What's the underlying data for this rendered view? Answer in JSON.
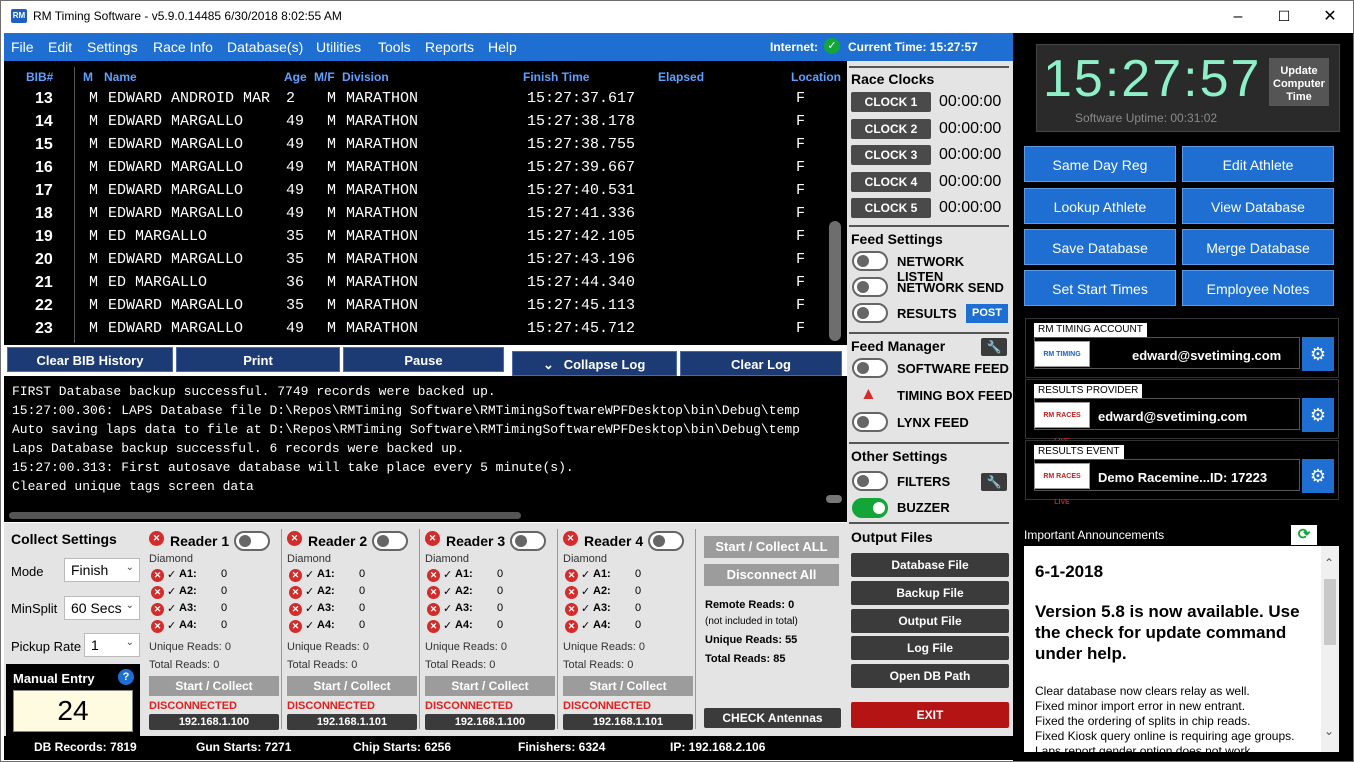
{
  "window": {
    "title": "RM Timing Software - v5.9.0.14485 6/30/2018 8:02:55 AM",
    "logo": "RM",
    "minimize": "–",
    "maximize": "☐",
    "close": "✕"
  },
  "menu": {
    "items": [
      "File",
      "Edit",
      "Settings",
      "Race Info",
      "Database(s)",
      "Utilities",
      "Tools",
      "Reports",
      "Help"
    ],
    "internet_label": "Internet:",
    "current_time": "Current Time: 15:27:57"
  },
  "grid": {
    "headers": {
      "bib": "BIB#",
      "m": "M",
      "name": "Name",
      "age": "Age",
      "mf": "M/F",
      "division": "Division",
      "finish": "Finish Time",
      "elapsed": "Elapsed",
      "location": "Location"
    },
    "rows": [
      {
        "bib": "13",
        "m": "M",
        "name": "EDWARD ANDROID MAR",
        "age": "2",
        "mf": "M",
        "division": "MARATHON",
        "finish": "15:27:37.617",
        "location": "F"
      },
      {
        "bib": "14",
        "m": "M",
        "name": "EDWARD MARGALLO",
        "age": "49",
        "mf": "M",
        "division": "MARATHON",
        "finish": "15:27:38.178",
        "location": "F"
      },
      {
        "bib": "15",
        "m": "M",
        "name": "EDWARD MARGALLO",
        "age": "49",
        "mf": "M",
        "division": "MARATHON",
        "finish": "15:27:38.755",
        "location": "F"
      },
      {
        "bib": "16",
        "m": "M",
        "name": "EDWARD MARGALLO",
        "age": "49",
        "mf": "M",
        "division": "MARATHON",
        "finish": "15:27:39.667",
        "location": "F"
      },
      {
        "bib": "17",
        "m": "M",
        "name": "EDWARD MARGALLO",
        "age": "49",
        "mf": "M",
        "division": "MARATHON",
        "finish": "15:27:40.531",
        "location": "F"
      },
      {
        "bib": "18",
        "m": "M",
        "name": "EDWARD MARGALLO",
        "age": "49",
        "mf": "M",
        "division": "MARATHON",
        "finish": "15:27:41.336",
        "location": "F"
      },
      {
        "bib": "19",
        "m": "M",
        "name": "ED MARGALLO",
        "age": "35",
        "mf": "M",
        "division": "MARATHON",
        "finish": "15:27:42.105",
        "location": "F"
      },
      {
        "bib": "20",
        "m": "M",
        "name": "EDWARD MARGALLO",
        "age": "35",
        "mf": "M",
        "division": "MARATHON",
        "finish": "15:27:43.196",
        "location": "F"
      },
      {
        "bib": "21",
        "m": "M",
        "name": "ED MARGALLO",
        "age": "36",
        "mf": "M",
        "division": "MARATHON",
        "finish": "15:27:44.340",
        "location": "F"
      },
      {
        "bib": "22",
        "m": "M",
        "name": "EDWARD MARGALLO",
        "age": "35",
        "mf": "M",
        "division": "MARATHON",
        "finish": "15:27:45.113",
        "location": "F"
      },
      {
        "bib": "23",
        "m": "M",
        "name": "EDWARD MARGALLO",
        "age": "49",
        "mf": "M",
        "division": "MARATHON",
        "finish": "15:27:45.712",
        "location": "F"
      }
    ]
  },
  "grid_buttons": {
    "clear_bib": "Clear BIB History",
    "print": "Print",
    "pause": "Pause",
    "collapse_log": "Collapse Log",
    "clear_log": "Clear Log"
  },
  "log": {
    "lines": [
      "FIRST Database backup successful. 7749 records were backed up.",
      "15:27:00.306: LAPS Database file D:\\Repos\\RMTiming Software\\RMTimingSoftwareWPFDesktop\\bin\\Debug\\temp",
      "Auto saving laps data to file at D:\\Repos\\RMTiming Software\\RMTimingSoftwareWPFDesktop\\bin\\Debug\\temp",
      "Laps Database backup successful. 6 records were backed up.",
      "15:27:00.313: First autosave database will take place every 5 minute(s).",
      "Cleared unique tags screen data"
    ]
  },
  "collect": {
    "title": "Collect Settings",
    "mode_label": "Mode",
    "mode_value": "Finish",
    "minsplit_label": "MinSplit",
    "minsplit_value": "60 Secs",
    "pickup_label": "Pickup Rate",
    "pickup_value": "1",
    "manual_title": "Manual Entry",
    "manual_help": "?",
    "manual_value": "24",
    "readers": [
      {
        "name": "Reader 1",
        "type": "Diamond",
        "antennas": [
          {
            "label": "A1:",
            "count": "0"
          },
          {
            "label": "A2:",
            "count": "0"
          },
          {
            "label": "A3:",
            "count": "0"
          },
          {
            "label": "A4:",
            "count": "0"
          }
        ],
        "unique": "Unique Reads: 0",
        "total": "Total Reads: 0",
        "button": "Start / Collect",
        "status": "DISCONNECTED",
        "ip": "192.168.1.100"
      },
      {
        "name": "Reader 2",
        "type": "Diamond",
        "antennas": [
          {
            "label": "A1:",
            "count": "0"
          },
          {
            "label": "A2:",
            "count": "0"
          },
          {
            "label": "A3:",
            "count": "0"
          },
          {
            "label": "A4:",
            "count": "0"
          }
        ],
        "unique": "Unique Reads: 0",
        "total": "Total Reads: 0",
        "button": "Start / Collect",
        "status": "DISCONNECTED",
        "ip": "192.168.1.101"
      },
      {
        "name": "Reader 3",
        "type": "Diamond",
        "antennas": [
          {
            "label": "A1:",
            "count": "0"
          },
          {
            "label": "A2:",
            "count": "0"
          },
          {
            "label": "A3:",
            "count": "0"
          },
          {
            "label": "A4:",
            "count": "0"
          }
        ],
        "unique": "Unique Reads: 0",
        "total": "Total Reads: 0",
        "button": "Start / Collect",
        "status": "DISCONNECTED",
        "ip": "192.168.1.100"
      },
      {
        "name": "Reader 4",
        "type": "Diamond",
        "antennas": [
          {
            "label": "A1:",
            "count": "0"
          },
          {
            "label": "A2:",
            "count": "0"
          },
          {
            "label": "A3:",
            "count": "0"
          },
          {
            "label": "A4:",
            "count": "0"
          }
        ],
        "unique": "Unique Reads: 0",
        "total": "Total Reads: 0",
        "button": "Start / Collect",
        "status": "DISCONNECTED",
        "ip": "192.168.1.101"
      }
    ],
    "start_all": "Start / Collect ALL",
    "disconnect_all": "Disconnect All",
    "remote_reads": "Remote Reads: 0",
    "not_included": "(not included in total)",
    "unique_reads": "Unique Reads: 55",
    "total_reads": "Total Reads: 85",
    "check_antennas": "CHECK Antennas"
  },
  "status": {
    "db_records": "DB Records: 7819",
    "gun_starts": "Gun Starts: 7271",
    "chip_starts": "Chip Starts: 6256",
    "finishers": "Finishers: 6324",
    "ip": "IP: 192.168.2.106"
  },
  "mid": {
    "race_clocks": "Race Clocks",
    "clocks": [
      {
        "label": "CLOCK 1",
        "value": "00:00:00"
      },
      {
        "label": "CLOCK 2",
        "value": "00:00:00"
      },
      {
        "label": "CLOCK 3",
        "value": "00:00:00"
      },
      {
        "label": "CLOCK 4",
        "value": "00:00:00"
      },
      {
        "label": "CLOCK 5",
        "value": "00:00:00"
      }
    ],
    "feed_settings": "Feed Settings",
    "network_listen": "NETWORK LISTEN",
    "network_send": "NETWORK SEND",
    "results": "RESULTS",
    "post": "POST",
    "feed_manager": "Feed Manager",
    "software_feed": "SOFTWARE FEED",
    "timing_box_feed": "TIMING BOX FEED",
    "lynx_feed": "LYNX FEED",
    "other_settings": "Other Settings",
    "filters": "FILTERS",
    "buzzer": "BUZZER",
    "output_files": "Output Files",
    "database_file": "Database File",
    "backup_file": "Backup File",
    "output_file": "Output File",
    "log_file": "Log File",
    "open_db_path": "Open DB Path",
    "exit": "EXIT"
  },
  "right": {
    "clock": "15:27:57",
    "uptime": "Software Uptime: 00:31:02",
    "update_time": "Update Computer Time",
    "buttons": [
      "Same Day Reg",
      "Edit Athlete",
      "Lookup Athlete",
      "View Database",
      "Save Database",
      "Merge Database",
      "Set Start Times",
      "Employee Notes"
    ],
    "accounts": [
      {
        "tab": "RM TIMING ACCOUNT",
        "logo": "RM TIMING",
        "email": "edward@svetiming.com"
      },
      {
        "tab": "RESULTS PROVIDER",
        "logo": "RM RACES LIVE",
        "email": "edward@svetiming.com"
      },
      {
        "tab": "RESULTS EVENT",
        "logo": "RM RACES LIVE",
        "email": "Demo Racemine...",
        "id": "ID: 17223"
      }
    ],
    "announcements_title": "Important Announcements",
    "ann_date": "6-1-2018",
    "ann_version": "Version 5.8 is now available. Use the check for update command under help.",
    "ann_notes": [
      "Clear database now clears relay as well.",
      "Fixed minor import error in new entrant.",
      "Fixed the ordering of splits in chip reads.",
      "Fixed Kiosk query online is requiring age groups.",
      "Laps report gender option does not work"
    ]
  }
}
